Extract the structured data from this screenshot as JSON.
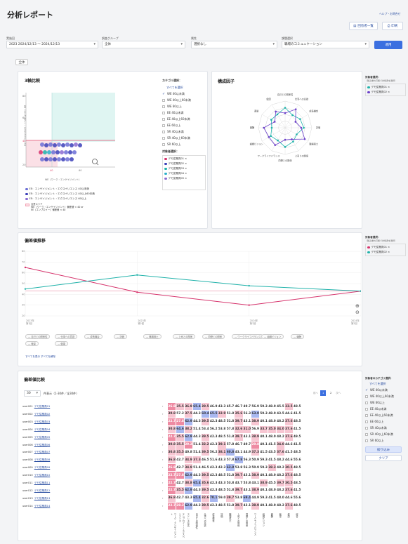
{
  "header": {
    "title": "分析レポート",
    "top_link": "ヘルプ・お問合せ",
    "btn_list": "回答者一覧",
    "btn_print": "印刷"
  },
  "filters": {
    "period_label": "実施回",
    "period_value": "2023 2024/12/13 〜 2024/12/13",
    "group_label": "調査グループ",
    "group_value": "全体",
    "attr_label": "属性",
    "attr_value": "選択なし",
    "topic_label": "課題選択",
    "topic_value": "職場のコミュニケーション",
    "apply": "適用",
    "tag": "全体"
  },
  "three_axis": {
    "title": "3軸比較",
    "category_label": "カテゴリ選択：",
    "select_all": "すべてを選択",
    "categories": [
      {
        "label": "WE 40以未満",
        "checked": true
      },
      {
        "label": "WE 40以上60未満",
        "checked": false
      },
      {
        "label": "WE 60以上",
        "checked": false
      },
      {
        "label": "EE 40以未満",
        "checked": false
      },
      {
        "label": "EE 40以上60未満",
        "checked": false
      },
      {
        "label": "EE 60以上",
        "checked": false
      },
      {
        "label": "SR 40以未満",
        "checked": false
      },
      {
        "label": "SR 40以上60未満",
        "checked": false
      },
      {
        "label": "SR 60以上",
        "checked": false
      }
    ],
    "target_label": "対象者選択：",
    "targets": [
      {
        "label": "デモ従業員01 ×",
        "color": "#d6336c"
      },
      {
        "label": "デモ従業員02 ×",
        "color": "#3b3fb8"
      },
      {
        "label": "デモ従業員03 ×",
        "color": "#20b2aa"
      },
      {
        "label": "デモ従業員04 ×",
        "color": "#2ab0c9"
      },
      {
        "label": "デモ従業員05 ×",
        "color": "#8a6bd1"
      }
    ],
    "xlabel": "WE（ワーク・エンゲイジメント）",
    "ylabel": "EE（エンプロイー・エクスペリエンス）",
    "yticks": [
      "80",
      "60",
      "40",
      "20"
    ],
    "xticks": [
      "40",
      "60"
    ],
    "legend": [
      "EE：エンゲイジメント・エクスペリエンス 40以未満",
      "EE：エンゲイジメント・エクスペリエンス 40以上60未満",
      "EE：エンゲイジメント・エクスペリエンス 60以上"
    ],
    "legend_note1": "注意エリア",
    "legend_note2": "WE（ワーク・エンゲイジメント）偏差値 < 40 or",
    "legend_note3": "EE（エンプロイー）偏差値 < 40"
  },
  "radar": {
    "title": "構成因子",
    "axes": [
      "自己との関係性",
      "仕事への意欲",
      "成長機会",
      "評価",
      "職場風土",
      "上司との関係",
      "同僚との関係",
      "ワークライフバランス",
      "組織ビジョン",
      "報酬",
      "裁量",
      "健康"
    ],
    "target_label": "対象者選択：",
    "target_note": "（積み重ね可能で対象者を選択）",
    "targets": [
      {
        "label": "デモ従業員01 ×",
        "color": "#20b2aa"
      },
      {
        "label": "デモ従業員02 ×",
        "color": "#6a3fc9"
      }
    ]
  },
  "trend": {
    "title": "偏差値推移",
    "yticks": [
      "80",
      "70",
      "60",
      "50",
      "40",
      "30",
      "20"
    ],
    "xticks": [
      "2023年\n第1回",
      "2023年\n第2回",
      "2024年\n第1回",
      "2024年\n第2回"
    ],
    "target_label": "対象者選択：",
    "target_note": "（積み重ね可能で対象者を選択）",
    "targets": [
      {
        "label": "デモ従業員01 ×",
        "color": "#d6336c"
      },
      {
        "label": "デモ従業員02 ×",
        "color": "#20b2aa"
      }
    ],
    "pills": [
      "自己との関係性",
      "仕事への意欲",
      "成長機会",
      "評価",
      "職場風土",
      "上司との関係",
      "同僚との関係",
      "ワークライフバランス",
      "組織ビジョン",
      "報酬",
      "裁量",
      "健康"
    ],
    "link_all": "すべてを表示",
    "link_clear": "すべてを解除"
  },
  "chart_data": {
    "type": "line",
    "x": [
      "2023年 第1回",
      "2023年 第2回",
      "2024年 第1回",
      "2024年 第2回"
    ],
    "ylim": [
      20,
      80
    ],
    "series": [
      {
        "name": "デモ従業員01",
        "values": [
          65,
          42,
          30,
          43
        ]
      },
      {
        "name": "デモ従業員02",
        "values": [
          45,
          58,
          48,
          43
        ]
      }
    ]
  },
  "deviation": {
    "title": "偏差値比較",
    "page_size": "30",
    "count_text": "件表示（1-30件／全30件）",
    "pager": {
      "prev": "前へ",
      "p1": "1",
      "p2": "2",
      "next": "次へ"
    },
    "rows": [
      {
        "id": "user001",
        "name": "デモ従業員01",
        "v": [
          "26.8",
          "35.5",
          "36.9",
          "65.4",
          "39.5",
          "46.9",
          "43.3",
          "45.7",
          "46.7",
          "49.7",
          "56.9",
          "59.3",
          "48.0",
          "45.5",
          "33.5",
          "48.5"
        ]
      },
      {
        "id": "user002",
        "name": "デモ従業員02",
        "v": [
          "30.8",
          "57.2",
          "37.5",
          "44.3",
          "60.4",
          "65.5",
          "32.9",
          "51.8",
          "35.6",
          "56.3",
          "63.0",
          "59.3",
          "48.0",
          "43.5",
          "44.6",
          "41.5"
        ]
      },
      {
        "id": "user003",
        "name": "デモ従業員03",
        "v": [
          "22.7",
          "27.8",
          "62.9",
          "44.3",
          "39.5",
          "42.3",
          "48.5",
          "51.8",
          "39.7",
          "43.1",
          "38.9",
          "40.1",
          "48.0",
          "48.2",
          "37.6",
          "48.5"
        ]
      },
      {
        "id": "user004",
        "name": "デモ従業員04",
        "v": [
          "30.8",
          "64.6",
          "38.2",
          "51.4",
          "53.4",
          "56.2",
          "53.8",
          "57.8",
          "32.6",
          "31.0",
          "56.9",
          "33.7",
          "35.0",
          "34.0",
          "37.6",
          "41.5"
        ]
      },
      {
        "id": "user005",
        "name": "デモ従業員05",
        "v": [
          "22.7",
          "35.5",
          "62.9",
          "44.3",
          "39.5",
          "42.3",
          "48.5",
          "51.8",
          "39.7",
          "43.1",
          "38.9",
          "40.1",
          "48.0",
          "48.2",
          "37.6",
          "49.5"
        ]
      },
      {
        "id": "user006",
        "name": "デモ従業員06",
        "v": [
          "30.8",
          "35.5",
          "29.2",
          "51.4",
          "32.2",
          "42.3",
          "39.1",
          "57.8",
          "46.7",
          "49.7",
          "29.8",
          "40.1",
          "41.5",
          "34.0",
          "44.6",
          "41.5"
        ]
      },
      {
        "id": "user007",
        "name": "デモ従業員07",
        "v": [
          "30.8",
          "35.5",
          "40.8",
          "51.4",
          "39.5",
          "56.2",
          "38.1",
          "60.8",
          "43.1",
          "44.9",
          "37.3",
          "41.5",
          "43.5",
          "37.6",
          "41.5",
          "48.5"
        ]
      },
      {
        "id": "user008",
        "name": "デモ従業員08",
        "v": [
          "36.8",
          "42.7",
          "34.9",
          "37.3",
          "46.5",
          "51.6",
          "43.3",
          "57.8",
          "67.8",
          "56.3",
          "50.9",
          "59.3",
          "41.5",
          "48.2",
          "44.6",
          "55.6"
        ]
      },
      {
        "id": "user009",
        "name": "デモ従業員09",
        "v": [
          "26.8",
          "42.7",
          "34.9",
          "51.4",
          "46.5",
          "42.3",
          "42.3",
          "63.8",
          "53.8",
          "56.3",
          "50.9",
          "59.3",
          "38.3",
          "48.2",
          "30.5",
          "48.5"
        ]
      },
      {
        "id": "user010",
        "name": "デモ従業員10",
        "v": [
          "22.7",
          "27.8",
          "62.9",
          "44.3",
          "39.5",
          "42.3",
          "48.5",
          "51.8",
          "39.7",
          "43.1",
          "38.9",
          "40.1",
          "48.0",
          "48.2",
          "37.6",
          "48.5"
        ]
      },
      {
        "id": "user011",
        "name": "デモ従業員11",
        "v": [
          "22.7",
          "42.7",
          "38.8",
          "65.4",
          "35.6",
          "42.3",
          "43.3",
          "53.8",
          "43.7",
          "53.8",
          "43.1",
          "38.9",
          "45.5",
          "39.7",
          "30.5",
          "48.5"
        ]
      },
      {
        "id": "user012",
        "name": "デモ従業員12",
        "v": [
          "22.7",
          "35.5",
          "62.9",
          "44.3",
          "39.5",
          "42.3",
          "48.5",
          "51.8",
          "39.7",
          "43.1",
          "38.9",
          "40.1",
          "48.0",
          "48.2",
          "37.6",
          "41.5"
        ]
      },
      {
        "id": "user013",
        "name": "デモ従業員13",
        "v": [
          "36.8",
          "42.7",
          "43.3",
          "65.4",
          "32.6",
          "70.1",
          "59.0",
          "39.7",
          "53.8",
          "69.4",
          "44.9",
          "59.3",
          "41.5",
          "48.0",
          "44.6",
          "55.6"
        ]
      },
      {
        "id": "user014",
        "name": "デモ従業員14",
        "v": [
          "22.7",
          "28.2",
          "62.9",
          "44.3",
          "39.5",
          "42.3",
          "48.5",
          "51.8",
          "39.7",
          "43.1",
          "38.9",
          "40.1",
          "48.0",
          "48.2",
          "37.6",
          "48.5"
        ]
      }
    ],
    "col_labels": [
      "ワーク・エンゲイジメント",
      "エンプロイー・エクスペリエンス",
      "ストレス反応",
      "自己との関係性",
      "仕事への意欲",
      "成長機会",
      "評価",
      "職場風土",
      "上司との関係",
      "同僚との関係",
      "ワークライフバランス",
      "組織ビジョン",
      "報酬",
      "裁量",
      "健康",
      "総合"
    ],
    "side_title": "対象者のカテゴリ選択：",
    "side_all": "すべてを選択",
    "side_items": [
      {
        "label": "WE 40以未満",
        "checked": true
      },
      {
        "label": "WE 40以上60未満",
        "checked": false
      },
      {
        "label": "WE 60以上",
        "checked": false
      },
      {
        "label": "EE 40以未満",
        "checked": false
      },
      {
        "label": "EE 40以上60未満",
        "checked": false
      },
      {
        "label": "EE 60以上",
        "checked": false
      },
      {
        "label": "SR 40以未満",
        "checked": false
      },
      {
        "label": "SR 40以上60未満",
        "checked": false
      },
      {
        "label": "SR 60以上",
        "checked": false
      }
    ],
    "side_apply": "絞り込み",
    "side_clear": "クリア"
  },
  "colors": {
    "accent": "#3b6fe0",
    "low": "#f3a3b4",
    "high": "#a9b8f0",
    "pink": "#d6336c",
    "teal": "#20b2aa"
  }
}
